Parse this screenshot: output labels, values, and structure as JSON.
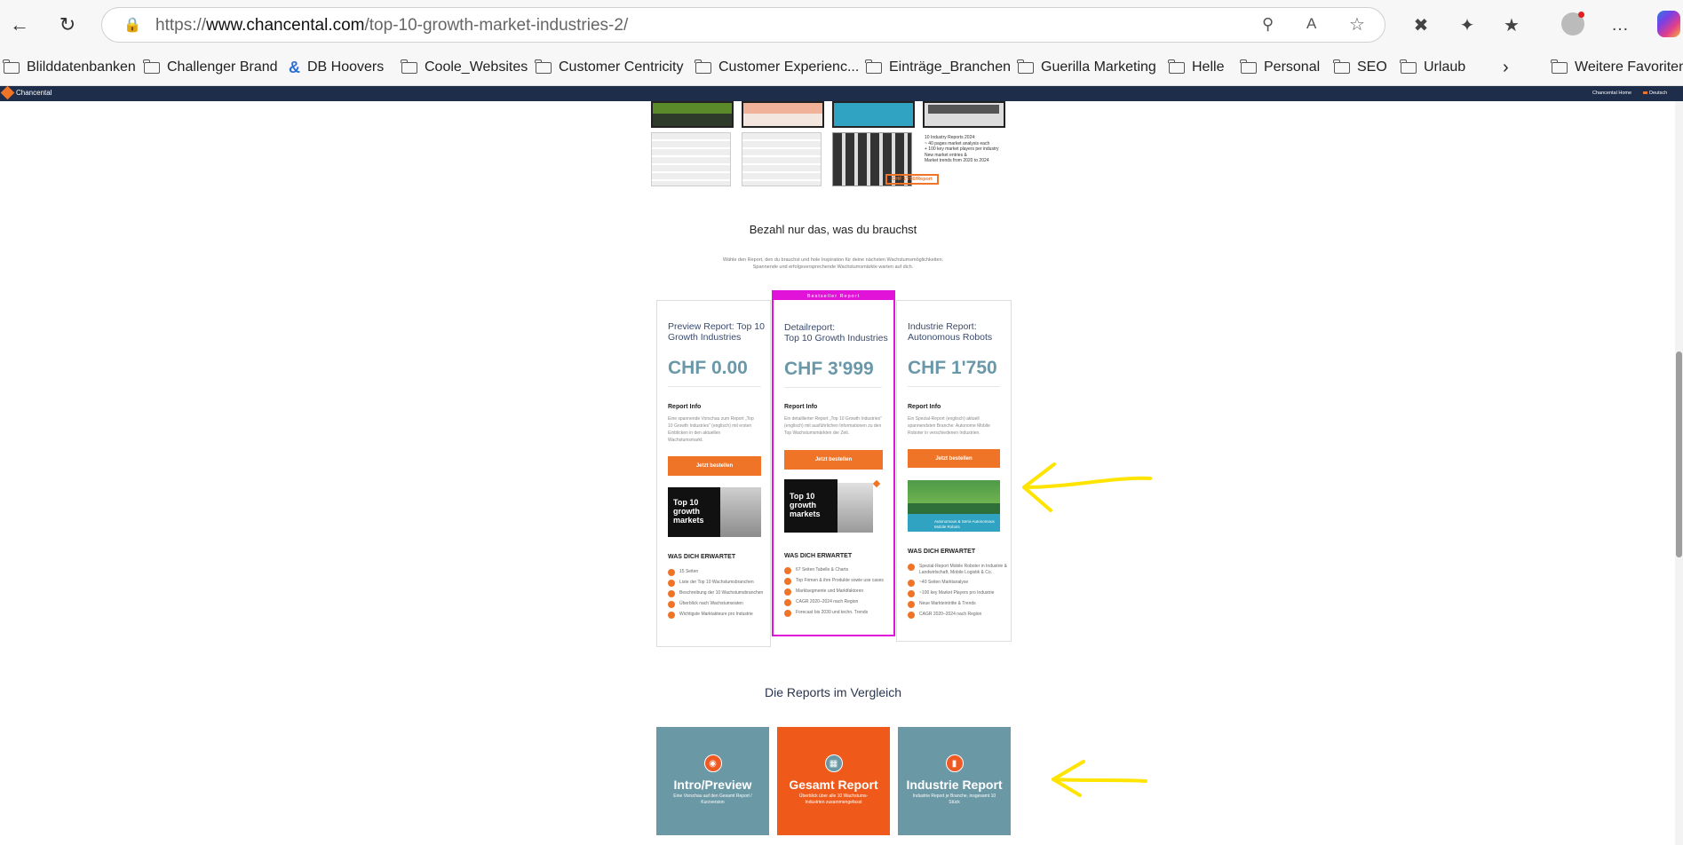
{
  "browser": {
    "url_prefix": "https://",
    "url_domain": "www.chancental.com",
    "url_path": "/top-10-growth-market-industries-2/",
    "bookmarks": [
      "Blilddatenbanken",
      "Challenger Brand",
      "DB Hoovers",
      "Coole_Websites",
      "Customer Centricity",
      "Customer Experienc...",
      "Einträge_Branchen",
      "Guerilla Marketing",
      "Helle",
      "Personal",
      "SEO",
      "Urlaub"
    ],
    "other_favorites": "Weitere Favoriten"
  },
  "site": {
    "logo_text": "Chancental",
    "nav_home": "Chancental Home",
    "nav_lang": "Deutsch"
  },
  "hero_promo": {
    "report_count": "10 Industry Reports 2024:",
    "bullets": [
      "~ 40 pages market analysis each",
      "+ 100 key market players per industry",
      "New market entries &",
      "Market trends from 2020 to 2024"
    ],
    "price_tag": "CHF 1'750/Report"
  },
  "pricing": {
    "heading": "Bezahl nur das, was du brauchst",
    "subtext_1": "Wähle den Report, den du brauchst und hole Inspiration für deine nächsten Wachstumsmöglichkeiten.",
    "subtext_2": "Spannende und erfolgsversprechende Wachstumsmärkte warten auf dich.",
    "bestseller_badge": "Bestseller Report",
    "cards": [
      {
        "title_1": "Preview Report: Top 10",
        "title_2": "Growth Industries",
        "price": "CHF 0.00",
        "info_label": "Report Info",
        "description": "Eine spannende Vorschau zum Report „Top 10 Growth Industries“ (englisch) mit ersten Einblicken in den aktuellen Wachstumsmarkt.",
        "button": "Jetzt bestellen",
        "thumb_text": "Top 10 growth markets",
        "expect_label": "WAS DICH ERWARTET",
        "features": [
          "15 Seiten",
          "Liste der Top 10 Wachstumsbranchen",
          "Beschreibung der 10 Wachstumsbranchen",
          "Überblick nach Wachstumsraten",
          "Wichtigste Marktakteure pro Industrie"
        ]
      },
      {
        "title_1": "Detailreport:",
        "title_2": "Top 10 Growth Industries",
        "price": "CHF 3'999",
        "info_label": "Report Info",
        "description": "Ein detaillierter Report „Top 10 Growth Industries“ (englisch) mit ausführlichen Informationen zu den Top Wachstumsmärkten der Zeit.",
        "button": "Jetzt bestellen",
        "thumb_text": "Top 10 growth markets",
        "expect_label": "WAS DICH ERWARTET",
        "features": [
          "67 Seiten Tabelle & Charts",
          "Top Firmen & ihre Produkte sowie use cases",
          "Marktsegmente und Marktfaktoren",
          "CAGR 2020–2024 nach Region",
          "Forecast bis 2030 und techn. Trends"
        ]
      },
      {
        "title_1": "Industrie Report:",
        "title_2": "Autonomous Robots",
        "price": "CHF 1'750",
        "info_label": "Report Info",
        "description": "Ein Spezial-Report (englisch) aktuell spannendsten Branche: Autonome Mobile Roboter in verschiedenen Industrien.",
        "button": "Jetzt bestellen",
        "thumb_text": "Autonomous & Semi-Autonomous Mobile Robots",
        "expect_label": "WAS DICH ERWARTET",
        "features": [
          "Spezial-Report Mobile Roboter in Industrie & Landwirtschaft, Mobile Logistik & Co.",
          "~40 Seiten Marktanalyse",
          "~100 key Market Players pro Industrie",
          "Neue Markteintritte & Trends",
          "CAGR 2020–2024 nach Region"
        ]
      }
    ]
  },
  "compare": {
    "heading": "Die Reports im Vergleich",
    "tiles": [
      {
        "title": "Intro/Preview",
        "text": "Eine Vorschau auf den Gesamt Report / Kurzversion",
        "color": "#6b98a5",
        "icon": "eye-icon"
      },
      {
        "title": "Gesamt Report",
        "text": "Überblick über alle 10 Wachstums-Industrien zusammengefasst",
        "color": "#ef5a1a",
        "icon": "document-icon"
      },
      {
        "title": "Industrie Report",
        "text": "Industrie Report je Branche, insgesamt 10 Stück",
        "color": "#6b98a5",
        "icon": "folder-icon"
      }
    ]
  },
  "colors": {
    "accent_orange": "#ef7428",
    "bestseller_magenta": "#e213d8",
    "price_teal": "#6a98a8",
    "site_navy": "#1e2d4a",
    "annotation_yellow": "#ffe400"
  }
}
